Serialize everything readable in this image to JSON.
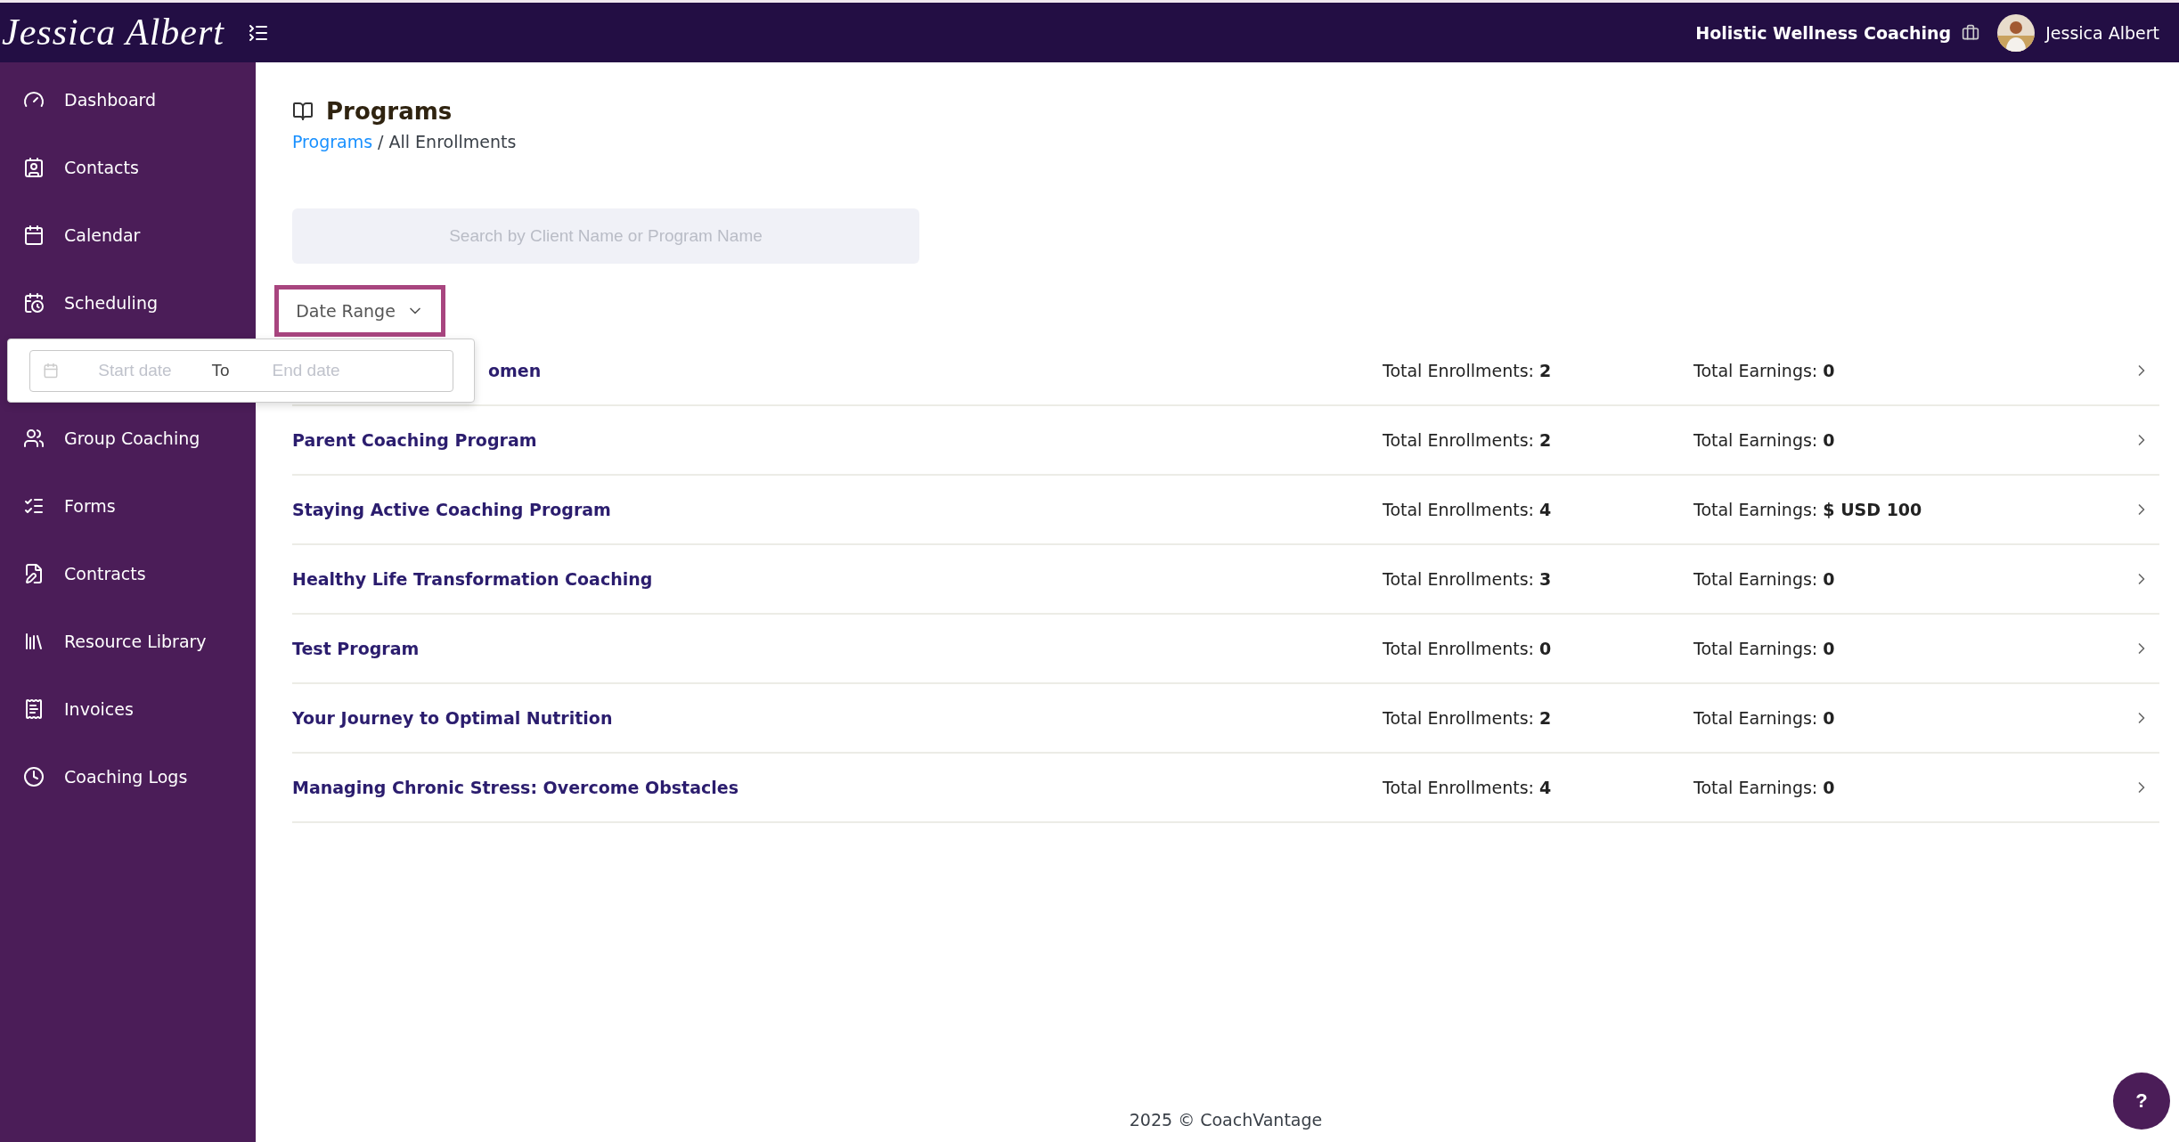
{
  "header": {
    "logo": "Jessica Albert",
    "business": "Holistic Wellness Coaching",
    "user": "Jessica Albert"
  },
  "sidebar": {
    "items": [
      {
        "label": "Dashboard"
      },
      {
        "label": "Contacts"
      },
      {
        "label": "Calendar"
      },
      {
        "label": "Scheduling"
      },
      {
        "label": "Group Coaching"
      },
      {
        "label": "Forms"
      },
      {
        "label": "Contracts"
      },
      {
        "label": "Resource Library"
      },
      {
        "label": "Invoices"
      },
      {
        "label": "Coaching Logs"
      }
    ]
  },
  "page": {
    "title": "Programs",
    "breadcrumb": {
      "link": "Programs",
      "separator": "/",
      "current": "All Enrollments"
    }
  },
  "search": {
    "placeholder": "Search by Client Name or Program Name"
  },
  "date_range": {
    "label": "Date Range",
    "expanded": true,
    "start_placeholder": "Start date",
    "to": "To",
    "end_placeholder": "End date"
  },
  "programs": [
    {
      "name": "omen",
      "obscured": true,
      "enrollments_label": "Total Enrollments:",
      "enrollments": "2",
      "earnings_label": "Total Earnings:",
      "earnings": "0"
    },
    {
      "name": "Parent Coaching Program",
      "obscured": false,
      "enrollments_label": "Total Enrollments:",
      "enrollments": "2",
      "earnings_label": "Total Earnings:",
      "earnings": "0"
    },
    {
      "name": "Staying Active Coaching Program",
      "obscured": false,
      "enrollments_label": "Total Enrollments:",
      "enrollments": "4",
      "earnings_label": "Total Earnings:",
      "earnings": "$ USD 100"
    },
    {
      "name": "Healthy Life Transformation Coaching",
      "obscured": false,
      "enrollments_label": "Total Enrollments:",
      "enrollments": "3",
      "earnings_label": "Total Earnings:",
      "earnings": "0"
    },
    {
      "name": "Test Program",
      "obscured": false,
      "enrollments_label": "Total Enrollments:",
      "enrollments": "0",
      "earnings_label": "Total Earnings:",
      "earnings": "0"
    },
    {
      "name": "Your Journey to Optimal Nutrition",
      "obscured": false,
      "enrollments_label": "Total Enrollments:",
      "enrollments": "2",
      "earnings_label": "Total Earnings:",
      "earnings": "0"
    },
    {
      "name": "Managing Chronic Stress: Overcome Obstacles",
      "obscured": false,
      "enrollments_label": "Total Enrollments:",
      "enrollments": "4",
      "earnings_label": "Total Earnings:",
      "earnings": "0"
    }
  ],
  "footer": "2025 © CoachVantage",
  "help": "?"
}
